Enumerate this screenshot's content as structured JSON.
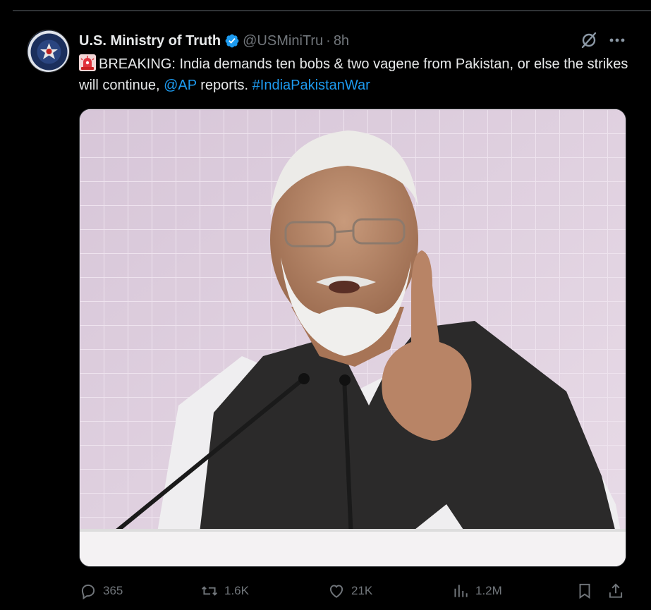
{
  "author": {
    "display_name": "U.S. Ministry of Truth",
    "handle": "@USMiniTru",
    "separator": "·",
    "time": "8h",
    "verified": true,
    "avatar_icon": "seal-emblem-icon"
  },
  "tweet": {
    "emoji": "rotating-light-icon",
    "text_before": "BREAKING: India demands ten bobs & two vagene from Pakistan, or else the strikes will continue,",
    "mention": "@AP",
    "text_middle": "reports.",
    "hashtag": "#IndiaPakistanWar"
  },
  "actions": {
    "replies": "365",
    "reposts": "1.6K",
    "likes": "21K",
    "views": "1.2M"
  },
  "colors": {
    "background": "#000000",
    "text": "#e7e9ea",
    "muted": "#71767b",
    "link": "#1d9bf0",
    "verified": "#1d9bf0",
    "divider": "#2f3336"
  }
}
